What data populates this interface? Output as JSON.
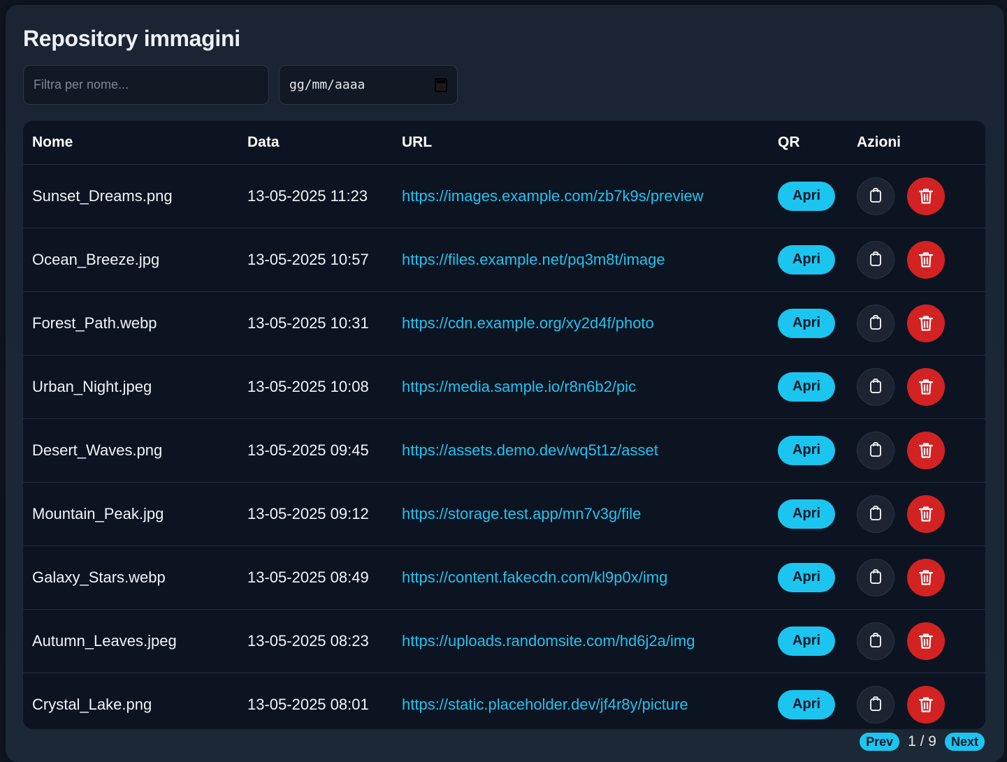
{
  "title": "Repository immagini",
  "filters": {
    "name_placeholder": "Filtra per nome...",
    "date_placeholder": "gg/mm/aaaa"
  },
  "table": {
    "headers": [
      "Nome",
      "Data",
      "URL",
      "QR",
      "Azioni"
    ],
    "rows": [
      {
        "name": "Sunset_Dreams.png",
        "date": "13-05-2025 11:23",
        "url": "https://images.example.com/zb7k9s/preview",
        "qr_label": "Apri"
      },
      {
        "name": "Ocean_Breeze.jpg",
        "date": "13-05-2025 10:57",
        "url": "https://files.example.net/pq3m8t/image",
        "qr_label": "Apri"
      },
      {
        "name": "Forest_Path.webp",
        "date": "13-05-2025 10:31",
        "url": "https://cdn.example.org/xy2d4f/photo",
        "qr_label": "Apri"
      },
      {
        "name": "Urban_Night.jpeg",
        "date": "13-05-2025 10:08",
        "url": "https://media.sample.io/r8n6b2/pic",
        "qr_label": "Apri"
      },
      {
        "name": "Desert_Waves.png",
        "date": "13-05-2025 09:45",
        "url": "https://assets.demo.dev/wq5t1z/asset",
        "qr_label": "Apri"
      },
      {
        "name": "Mountain_Peak.jpg",
        "date": "13-05-2025 09:12",
        "url": "https://storage.test.app/mn7v3g/file",
        "qr_label": "Apri"
      },
      {
        "name": "Galaxy_Stars.webp",
        "date": "13-05-2025 08:49",
        "url": "https://content.fakecdn.com/kl9p0x/img",
        "qr_label": "Apri"
      },
      {
        "name": "Autumn_Leaves.jpeg",
        "date": "13-05-2025 08:23",
        "url": "https://uploads.randomsite.com/hd6j2a/img",
        "qr_label": "Apri"
      },
      {
        "name": "Crystal_Lake.png",
        "date": "13-05-2025 08:01",
        "url": "https://static.placeholder.dev/jf4r8y/picture",
        "qr_label": "Apri"
      }
    ]
  },
  "pagination": {
    "prev_label": "Prev",
    "next_label": "Next",
    "current": 1,
    "total": 9,
    "page_text": "1 / 9"
  },
  "icons": {
    "copy": "copy-icon",
    "delete": "trash-icon",
    "calendar": "calendar-icon"
  },
  "colors": {
    "accent": "#1cc5ef",
    "link": "#22c3ee",
    "danger": "#d32222",
    "panel_bg": "#1f2937",
    "table_bg": "#0c1422"
  }
}
